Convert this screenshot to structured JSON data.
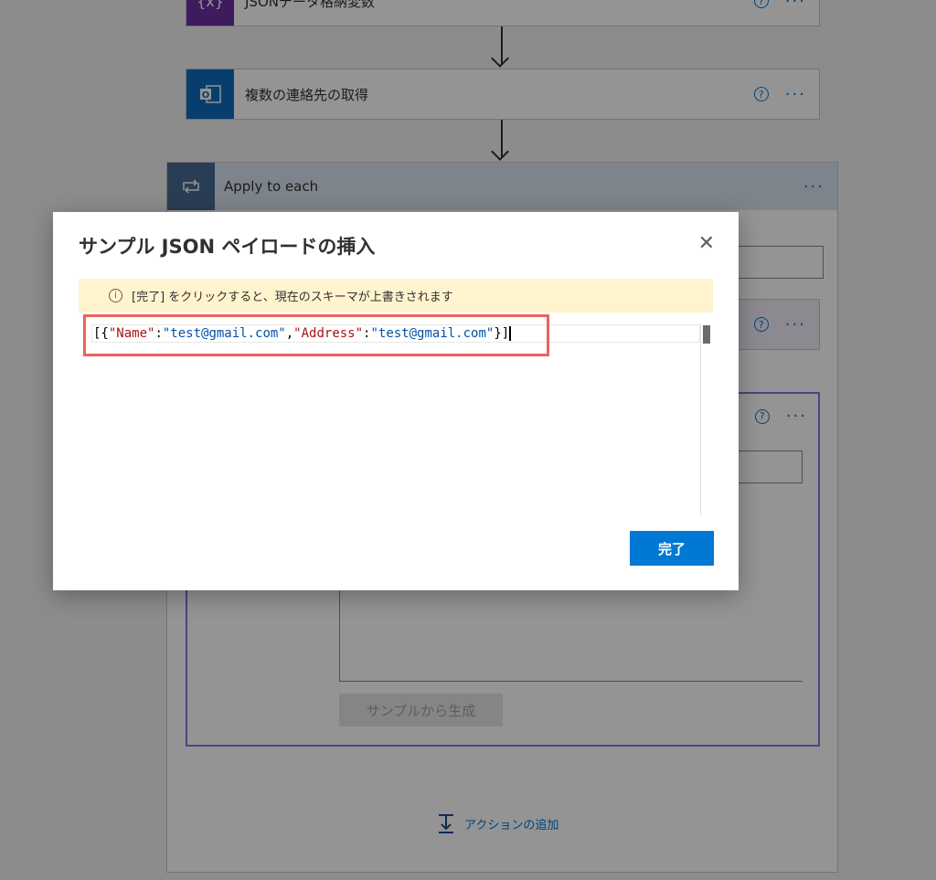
{
  "flow": {
    "step1": {
      "title": "JSONデータ格納変数",
      "icon": "variable-icon",
      "color": "#6b2fa3"
    },
    "step2": {
      "title": "複数の連絡先の取得",
      "icon": "outlook-icon",
      "color": "#0f6cbd"
    },
    "apply_each": {
      "title": "Apply to each",
      "icon": "loop-icon",
      "color": "#486991"
    },
    "help_glyph": "?",
    "more_glyph": "···",
    "generate_label": "サンプルから生成",
    "add_action_label": "アクションの追加"
  },
  "dialog": {
    "title": "サンプル JSON ペイロードの挿入",
    "close_glyph": "✕",
    "info_icon": "info-icon",
    "info_glyph": "i",
    "info_text": "[完了] をクリックすると、現在のスキーマが上書きされます",
    "editor": {
      "tokens": {
        "open": "[{",
        "key1": "\"Name\"",
        "colon1": ":",
        "val1": "\"test@gmail.com\"",
        "comma": ",",
        "key2": "\"Address\"",
        "colon2": ":",
        "val2": "\"test@gmail.com\"",
        "close": "}]"
      }
    },
    "done_label": "完了",
    "highlight_color": "#e8665a"
  }
}
